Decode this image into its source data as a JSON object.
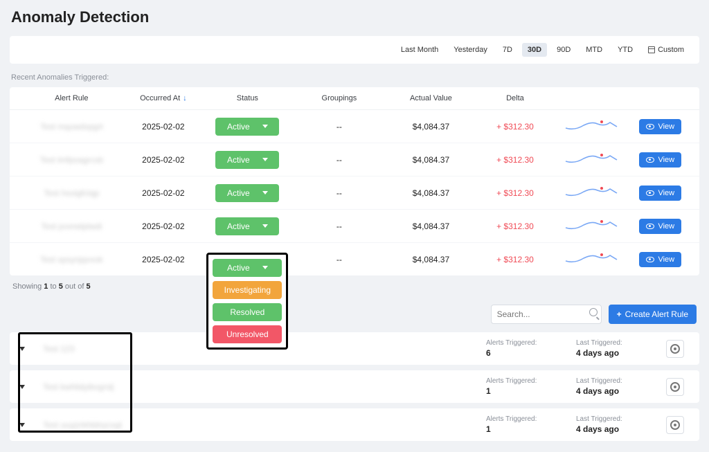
{
  "page_title": "Anomaly Detection",
  "time_ranges": [
    "Last Month",
    "Yesterday",
    "7D",
    "30D",
    "90D",
    "MTD",
    "YTD"
  ],
  "time_custom_label": "Custom",
  "active_time_range": "30D",
  "section_subtitle": "Recent Anomalies Triggered:",
  "columns": [
    "Alert Rule",
    "Occurred At",
    "Status",
    "Groupings",
    "Actual Value",
    "Delta",
    "",
    ""
  ],
  "sort_column": "Occurred At",
  "rows": [
    {
      "rule": "Test mquwdxpgrt",
      "occurred": "2025-02-02",
      "status": "Active",
      "groupings": "--",
      "actual": "$4,084.37",
      "delta": "+ $312.30"
    },
    {
      "rule": "Test tmfpoagrcxb",
      "occurred": "2025-02-02",
      "status": "Active",
      "groupings": "--",
      "actual": "$4,084.37",
      "delta": "+ $312.30"
    },
    {
      "rule": "Test hsoigfctqp",
      "occurred": "2025-02-02",
      "status": "Active",
      "groupings": "--",
      "actual": "$4,084.37",
      "delta": "+ $312.30"
    },
    {
      "rule": "Test pvxrwtptwdi",
      "occurred": "2025-02-02",
      "status": "Active",
      "groupings": "--",
      "actual": "$4,084.37",
      "delta": "+ $312.30"
    },
    {
      "rule": "Test xpsynjqvvok",
      "occurred": "2025-02-02",
      "status": "Active",
      "groupings": "--",
      "actual": "$4,084.37",
      "delta": "+ $312.30"
    }
  ],
  "status_options": [
    "Active",
    "Investigating",
    "Resolved",
    "Unresolved"
  ],
  "view_label": "View",
  "pager_prefix": "Showing ",
  "pager_from": "1",
  "pager_to_word": " to ",
  "pager_to": "5",
  "pager_outof": " out of ",
  "pager_total": "5",
  "search_placeholder": "Search...",
  "create_label": "Create Alert Rule",
  "alert_list": [
    {
      "name": "Test 123",
      "alerts_label": "Alerts Triggered:",
      "alerts": "6",
      "last_label": "Last Triggered:",
      "last": "4 days ago"
    },
    {
      "name": "Test kwhlidyibvgrslj",
      "alerts_label": "Alerts Triggered:",
      "alerts": "1",
      "last_label": "Last Triggered:",
      "last": "4 days ago"
    },
    {
      "name": "Test uuyjzrkhldnycxgt",
      "alerts_label": "Alerts Triggered:",
      "alerts": "1",
      "last_label": "Last Triggered:",
      "last": "4 days ago"
    }
  ]
}
